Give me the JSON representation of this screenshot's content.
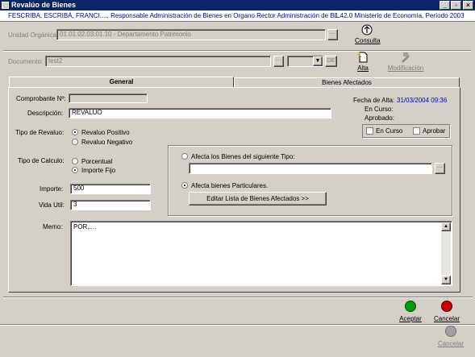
{
  "window": {
    "title": "Revalúo de Bienes",
    "min": "_",
    "max": "▫",
    "close": "×"
  },
  "infobar": {
    "user": "FESCRIBA, ESCRIBÁ, FRANCI...., Responsable Administración de Bienes en Organo Rector Administración de Bi...",
    "version": "1.42.0 Ministerio de Economía, Período 2003"
  },
  "unidad": {
    "label": "Unidad Orgánica:",
    "value": "01.01.02.03.01.10 - Departamento Patrimonio",
    "consulta": "Consulta"
  },
  "documento": {
    "label": "Documento:",
    "value": "test2",
    "de": "DE",
    "alta": "Alta",
    "modificacion": "Modificación"
  },
  "tabs": [
    {
      "label": "General"
    },
    {
      "label": "Bienes Afectados"
    }
  ],
  "form": {
    "comprobante_label": "Comprobante Nº:",
    "comprobante_value": "",
    "descripcion_label": "Descripción:",
    "descripcion_value": "REVALUO",
    "fecha_alta_label": "Fecha de Alta:",
    "fecha_alta_value": "31/03/2004 09:36",
    "en_curso_label": "En Curso:",
    "aprobado_label": "Aprobado:",
    "chk_en_curso": "En Curso",
    "chk_aprobar": "Aprobar",
    "tipo_revaluo_label": "Tipo de Revaluo:",
    "revaluo_positivo": "Revaluo Positivo",
    "revaluo_negativo": "Revaluo Negativo",
    "tipo_calculo_label": "Tipo de Calculo:",
    "porcentual": "Porcentual",
    "importe_fijo": "Importe Fijo",
    "importe_label": "Importe:",
    "importe_value": "500",
    "vida_util_label": "Vida Util:",
    "vida_util_value": "3",
    "afecta_tipo": "Afecta los Bienes del siguiente Tipo:",
    "afecta_particulares": "Afecta bienes Particulares.",
    "editar_lista": "Editar Lista de Bienes Afectados  >>",
    "memo_label": "Memo:",
    "memo_value": "POR,...."
  },
  "actions": {
    "aceptar": "Aceptar",
    "cancelar": "Cancelar",
    "cancelar2": "Cancelar"
  },
  "colors": {
    "title_bg": "#0a246a",
    "info_text": "#0000a0",
    "green": "#00a000",
    "red": "#d00000",
    "gray_btn": "#a0a0a0"
  }
}
